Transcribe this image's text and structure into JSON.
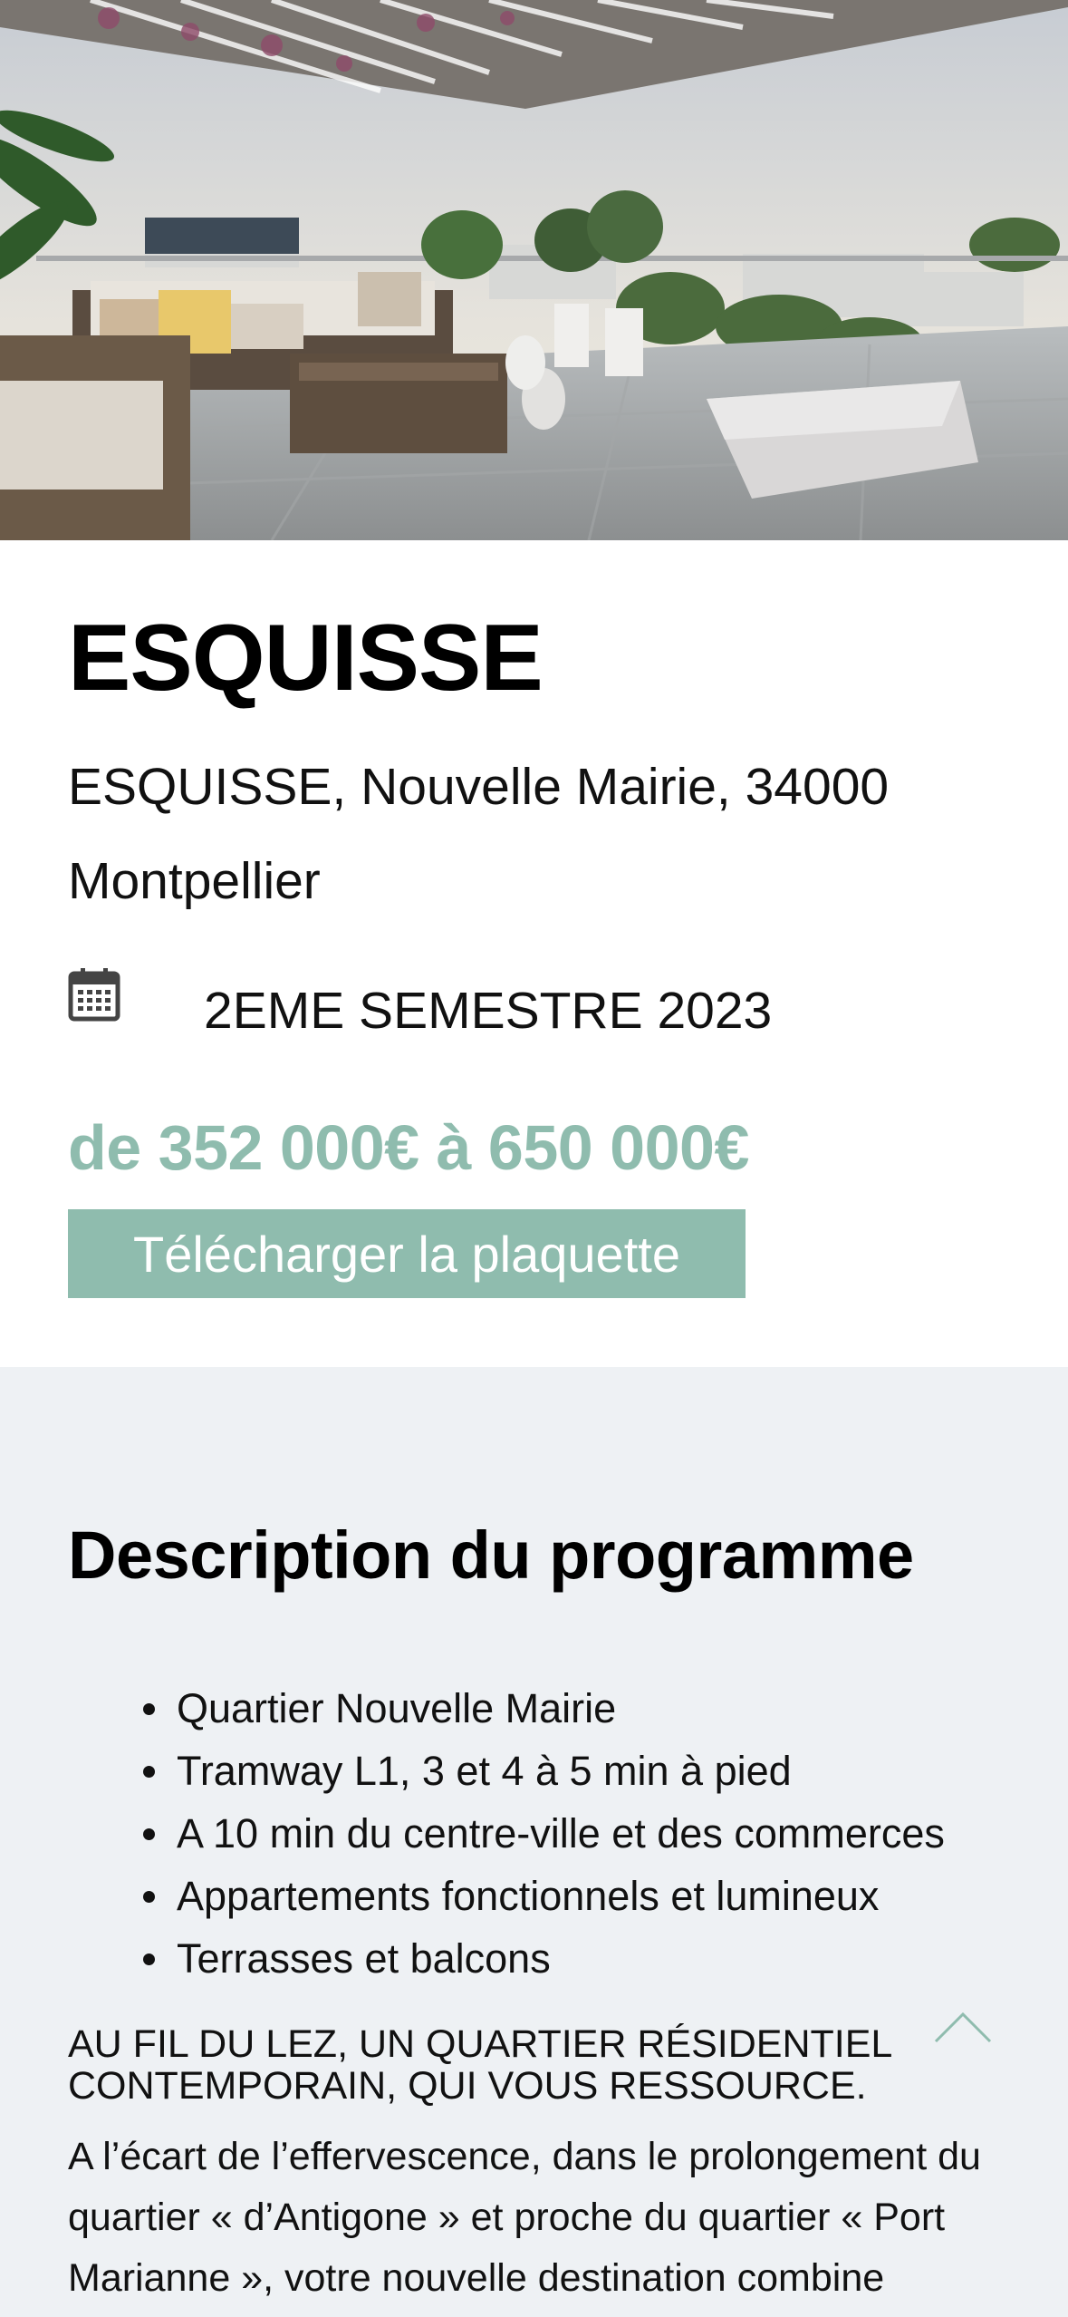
{
  "hero": {
    "image_description_icon": "terrace-photo"
  },
  "program": {
    "title": "ESQUISSE",
    "address": "ESQUISSE, Nouvelle Mairie, 34000 Montpellier",
    "delivery": "2EME SEMESTRE 2023",
    "price_range": "de 352 000€ à 650 000€",
    "download_label": "Télécharger la plaquette"
  },
  "description": {
    "heading": "Description du programme",
    "features": [
      "Quartier Nouvelle Mairie",
      "Tramway L1, 3 et 4 à 5 min à pied",
      "A 10 min du centre-ville et des commerces",
      "Appartements fonctionnels et lumineux",
      "Terrasses et balcons"
    ],
    "subheading": "AU FIL DU LEZ, UN QUARTIER RÉSIDENTIEL CONTEMPORAIN, QUI VOUS RESSOURCE.",
    "body": "A l’écart de l’effervescence, dans le prolongement du quartier « d’Antigone » et proche du quartier « Port Marianne », votre nouvelle destination combine"
  },
  "icons": {
    "calendar": "calendar-icon",
    "scroll_top": "chevron-up-icon"
  },
  "colors": {
    "accent": "#8fbcae",
    "section_bg": "#eef1f4"
  }
}
